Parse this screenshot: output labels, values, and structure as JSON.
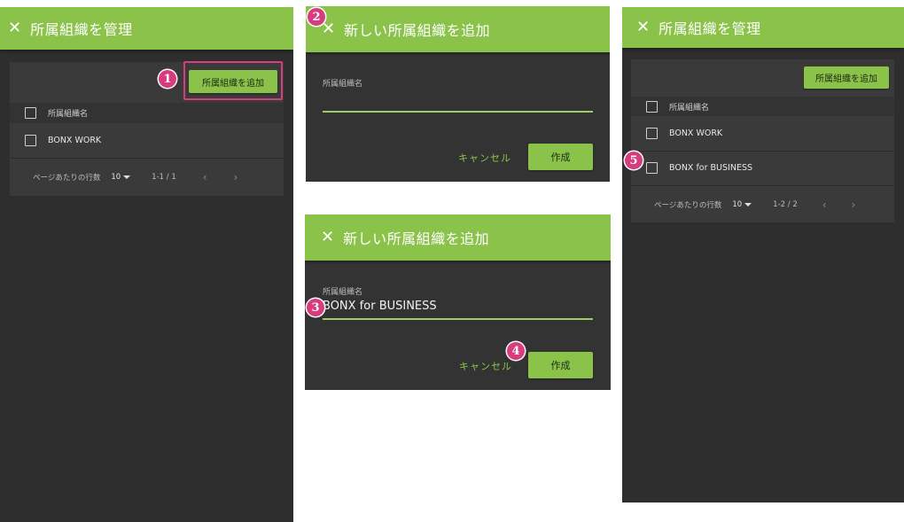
{
  "manage_panel_1": {
    "close_icon": "✕",
    "title": "所属組織を管理",
    "add_button": "所属組織を追加",
    "column_header": "所属組織名",
    "rows": [
      "BONX WORK"
    ],
    "pager": {
      "label": "ページあたりの行数",
      "rows_per_page": "10",
      "range": "1-1 / 1",
      "prev": "‹",
      "next": "›"
    }
  },
  "dialog_empty": {
    "close_icon": "✕",
    "title": "新しい所属組織を追加",
    "field_label": "所属組織名",
    "field_value": "",
    "cancel": "キャンセル",
    "create": "作成"
  },
  "dialog_filled": {
    "close_icon": "✕",
    "title": "新しい所属組織を追加",
    "field_label": "所属組織名",
    "field_value": "BONX for BUSINESS",
    "cancel": "キャンセル",
    "create": "作成"
  },
  "manage_panel_2": {
    "close_icon": "✕",
    "title": "所属組織を管理",
    "add_button": "所属組織を追加",
    "column_header": "所属組織名",
    "rows": [
      "BONX WORK",
      "BONX for BUSINESS"
    ],
    "pager": {
      "label": "ページあたりの行数",
      "rows_per_page": "10",
      "range": "1-2 / 2",
      "prev": "‹",
      "next": "›"
    }
  },
  "step_markers": [
    "1",
    "2",
    "3",
    "4",
    "5"
  ],
  "colors": {
    "accent": "#8bc34a",
    "marker": "#d63c7e",
    "panel_bg": "#2e2e2e",
    "card_bg": "#3a3a3a"
  }
}
